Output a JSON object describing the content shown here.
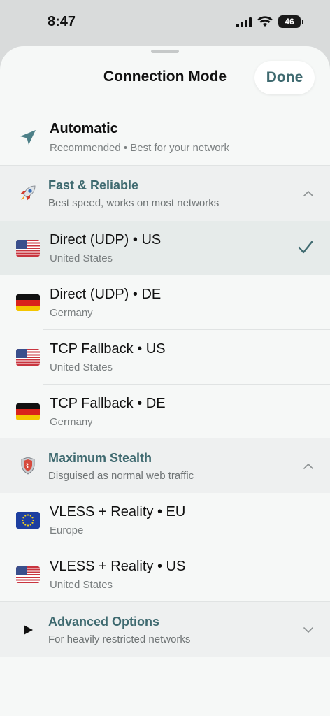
{
  "status_bar": {
    "time": "8:47",
    "battery": "46"
  },
  "sheet": {
    "title": "Connection Mode",
    "done_label": "Done"
  },
  "automatic": {
    "title": "Automatic",
    "subtitle": "Recommended • Best for your network",
    "icon": "location-arrow-icon"
  },
  "sections": [
    {
      "title": "Fast & Reliable",
      "subtitle": "Best speed, works on most networks",
      "icon": "rocket-icon",
      "expanded": true,
      "items": [
        {
          "title": "Direct (UDP) • US",
          "subtitle": "United States",
          "flag": "us-flag-icon",
          "selected": true
        },
        {
          "title": "Direct (UDP) • DE",
          "subtitle": "Germany",
          "flag": "de-flag-icon",
          "selected": false
        },
        {
          "title": "TCP Fallback • US",
          "subtitle": "United States",
          "flag": "us-flag-icon",
          "selected": false
        },
        {
          "title": "TCP Fallback • DE",
          "subtitle": "Germany",
          "flag": "de-flag-icon",
          "selected": false
        }
      ]
    },
    {
      "title": "Maximum Stealth",
      "subtitle": "Disguised as normal web traffic",
      "icon": "shield-icon",
      "expanded": true,
      "items": [
        {
          "title": "VLESS + Reality • EU",
          "subtitle": "Europe",
          "flag": "eu-flag-icon",
          "selected": false
        },
        {
          "title": "VLESS + Reality • US",
          "subtitle": "United States",
          "flag": "us-flag-icon",
          "selected": false
        }
      ]
    },
    {
      "title": "Advanced Options",
      "subtitle": "For heavily restricted networks",
      "icon": "play-icon",
      "expanded": false,
      "items": []
    }
  ],
  "colors": {
    "accent": "#3f6a70",
    "section_bg": "#eef0f0",
    "selected_bg": "#e6ebea"
  }
}
